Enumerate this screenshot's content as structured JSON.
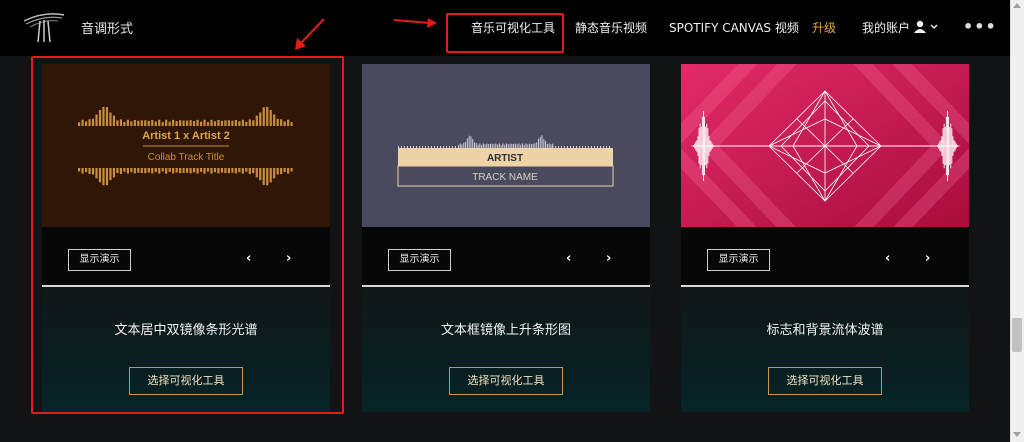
{
  "header": {
    "brand": "音调形式",
    "nav": {
      "music_visualizer": "音乐可视化工具",
      "static_music_video": "静态音乐视频",
      "spotify_canvas": "SPOTIFY CANVAS 视频",
      "upgrade": "升级",
      "my_account": "我的账户",
      "more": "•••"
    }
  },
  "cards": [
    {
      "preview": {
        "artist": "Artist 1 x Artist 2",
        "track": "Collab Track Title"
      },
      "demo_label": "显示演示",
      "prev": "‹",
      "next": "›",
      "title": "文本居中双镜像条形光谱",
      "select_label": "选择可视化工具"
    },
    {
      "preview": {
        "artist": "ARTIST",
        "track": "TRACK NAME"
      },
      "demo_label": "显示演示",
      "prev": "‹",
      "next": "›",
      "title": "文本框镜像上升条形图",
      "select_label": "选择可视化工具"
    },
    {
      "demo_label": "显示演示",
      "prev": "‹",
      "next": "›",
      "title": "标志和背景流体波谱",
      "select_label": "选择可视化工具"
    }
  ],
  "colors": {
    "accent": "#e0a93a",
    "annotation": "#e51b1b",
    "card1_bg": "#2f1606",
    "card2_bg": "#4a4a5e",
    "card3_bg": "#c0154a"
  }
}
